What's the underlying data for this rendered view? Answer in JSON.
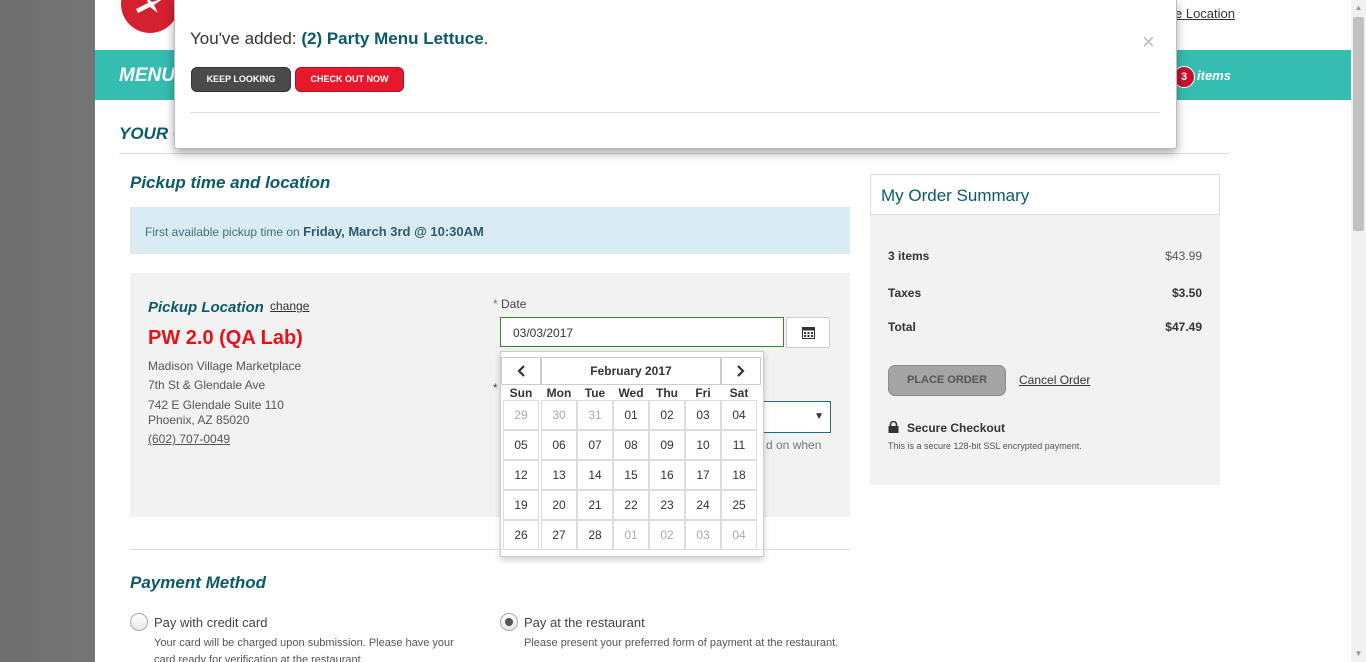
{
  "header": {
    "change_location": "e Location",
    "menu": "MENU",
    "cart_count": "3",
    "cart_label": "items"
  },
  "page": {
    "your_order": "YOUR O"
  },
  "pickup": {
    "section_title": "Pickup time and location",
    "first_available_prefix": "First available pickup time on",
    "first_available_value": "Friday, March 3rd @ 10:30AM",
    "location_title": "Pickup Location",
    "change_link": "change",
    "location_name": "PW 2.0 (QA Lab)",
    "address_lines": [
      "Madison Village Marketplace",
      "7th St & Glendale Ave",
      "742 E Glendale Suite 110",
      "Phoenix, AZ 85020"
    ],
    "phone": "(602) 707-0049",
    "date_label": "Date",
    "date_required_star": "*",
    "date_value": "03/03/2017",
    "behind_text": "d on when"
  },
  "datepicker": {
    "month_title": "February 2017",
    "weekdays": [
      "Sun",
      "Mon",
      "Tue",
      "Wed",
      "Thu",
      "Fri",
      "Sat"
    ],
    "weeks": [
      [
        {
          "d": "29",
          "muted": true
        },
        {
          "d": "30",
          "muted": true
        },
        {
          "d": "31",
          "muted": true
        },
        {
          "d": "01",
          "muted": false
        },
        {
          "d": "02",
          "muted": false
        },
        {
          "d": "03",
          "muted": false
        },
        {
          "d": "04",
          "muted": false
        }
      ],
      [
        {
          "d": "05",
          "muted": false
        },
        {
          "d": "06",
          "muted": false
        },
        {
          "d": "07",
          "muted": false
        },
        {
          "d": "08",
          "muted": false
        },
        {
          "d": "09",
          "muted": false
        },
        {
          "d": "10",
          "muted": false
        },
        {
          "d": "11",
          "muted": false
        }
      ],
      [
        {
          "d": "12",
          "muted": false
        },
        {
          "d": "13",
          "muted": false
        },
        {
          "d": "14",
          "muted": false
        },
        {
          "d": "15",
          "muted": false
        },
        {
          "d": "16",
          "muted": false
        },
        {
          "d": "17",
          "muted": false
        },
        {
          "d": "18",
          "muted": false
        }
      ],
      [
        {
          "d": "19",
          "muted": false
        },
        {
          "d": "20",
          "muted": false
        },
        {
          "d": "21",
          "muted": false
        },
        {
          "d": "22",
          "muted": false
        },
        {
          "d": "23",
          "muted": false
        },
        {
          "d": "24",
          "muted": false
        },
        {
          "d": "25",
          "muted": false
        }
      ],
      [
        {
          "d": "26",
          "muted": false
        },
        {
          "d": "27",
          "muted": false
        },
        {
          "d": "28",
          "muted": false
        },
        {
          "d": "01",
          "muted": true
        },
        {
          "d": "02",
          "muted": true
        },
        {
          "d": "03",
          "muted": true
        },
        {
          "d": "04",
          "muted": true
        }
      ]
    ]
  },
  "payment": {
    "section_title": "Payment Method",
    "credit_label": "Pay with credit card",
    "credit_sub": "Your card will be charged upon submission. Please have your card ready for verification at the restaurant.",
    "restaurant_label": "Pay at the restaurant",
    "restaurant_sub": "Please present your preferred form of payment at the restaurant.",
    "selected": "restaurant"
  },
  "summary": {
    "title": "My Order Summary",
    "items_label": "3 items",
    "items_value": "$43.99",
    "taxes_label": "Taxes",
    "taxes_value": "$3.50",
    "total_label": "Total",
    "total_value": "$47.49",
    "place_order": "PLACE ORDER",
    "cancel_order": "Cancel Order",
    "secure_title": "Secure Checkout",
    "secure_sub": "This is a secure 128-bit SSL encrypted payment."
  },
  "modal": {
    "prefix": "You've added:",
    "item": "(2) Party Menu Lettuce",
    "suffix": ".",
    "keep_looking": "KEEP LOOKING",
    "check_out": "CHECK OUT NOW",
    "close": "×"
  },
  "colors": {
    "teal": "#36bdb2",
    "dark_teal": "#0b5a68",
    "red": "#e8182c",
    "badge": "#c8102e"
  }
}
